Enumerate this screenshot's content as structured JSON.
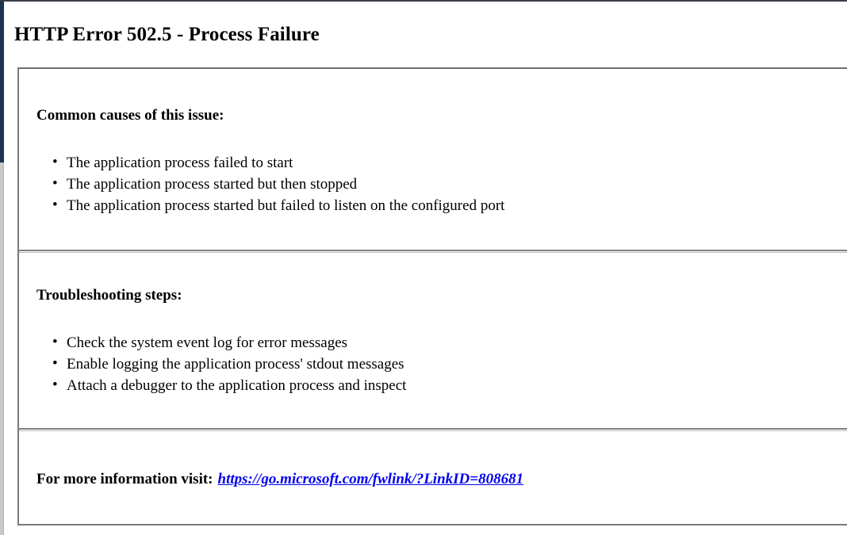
{
  "window": {
    "accent_rail_color": "#1b3250",
    "chrome_edge_color": "#3a3f46"
  },
  "page": {
    "title": "HTTP Error 502.5 - Process Failure",
    "box_border_color": "#7a7a7a",
    "link_color": "#0000ee"
  },
  "sections": {
    "causes": {
      "heading": "Common causes of this issue:",
      "items": [
        "The application process failed to start",
        "The application process started but then stopped",
        "The application process started but failed to listen on the configured port"
      ]
    },
    "troubleshooting": {
      "heading": "Troubleshooting steps:",
      "items": [
        "Check the system event log for error messages",
        "Enable logging the application process' stdout messages",
        "Attach a debugger to the application process and inspect"
      ]
    },
    "more_info": {
      "label": "For more information visit:",
      "link_text": "https://go.microsoft.com/fwlink/?LinkID=808681"
    }
  }
}
